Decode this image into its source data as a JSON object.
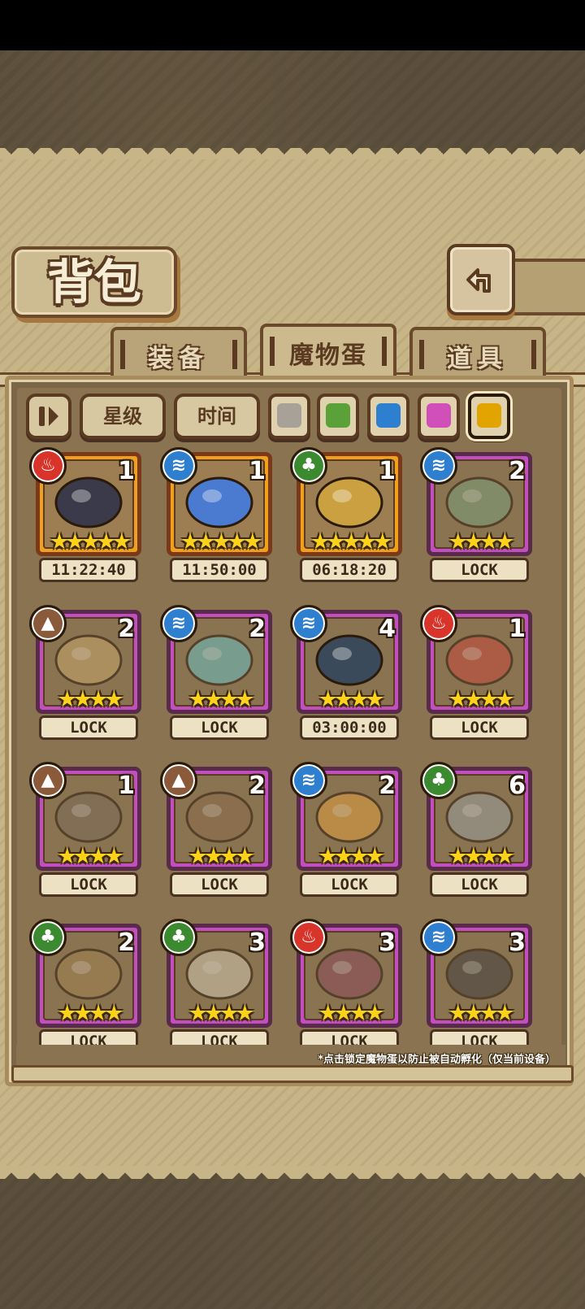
{
  "header": {
    "title": "背包"
  },
  "tabs": [
    {
      "label": "装备",
      "active": false
    },
    {
      "label": "魔物蛋",
      "active": true
    },
    {
      "label": "道具",
      "active": false
    }
  ],
  "filters": {
    "sort_toggle_icon": "sort-order-icon",
    "star_label": "星级",
    "time_label": "时间",
    "color_filters": [
      {
        "name": "gray",
        "color": "#a8a198"
      },
      {
        "name": "green",
        "color": "#5aa13a"
      },
      {
        "name": "blue",
        "color": "#2f7fd0"
      },
      {
        "name": "pink",
        "color": "#d04fb8"
      },
      {
        "name": "gold",
        "color": "#e2a400",
        "selected": true
      }
    ]
  },
  "eggs": [
    {
      "element": "fire",
      "count": "1",
      "stars": "★★★★★",
      "label": "11:22:40",
      "rarity": "gold",
      "icon": "pirate-hat-icon"
    },
    {
      "element": "water",
      "count": "1",
      "stars": "★★★★★",
      "label": "11:50:00",
      "rarity": "gold",
      "icon": "shark-fin-icon"
    },
    {
      "element": "grass",
      "count": "1",
      "stars": "★★★★★",
      "label": "06:18:20",
      "rarity": "gold",
      "icon": "magic-lamp-icon"
    },
    {
      "element": "water",
      "count": "2",
      "stars": "★★★★",
      "label": "LOCK",
      "rarity": "pink",
      "icon": "jellyfish-icon"
    },
    {
      "element": "earth",
      "count": "2",
      "stars": "★★★★",
      "label": "LOCK",
      "rarity": "pink",
      "icon": "furry-beast-icon"
    },
    {
      "element": "water",
      "count": "2",
      "stars": "★★★★",
      "label": "LOCK",
      "rarity": "pink",
      "icon": "spirit-blob-icon"
    },
    {
      "element": "water",
      "count": "4",
      "stars": "★★★★",
      "label": "03:00:00",
      "rarity": "pink",
      "icon": "hooded-knight-icon"
    },
    {
      "element": "fire",
      "count": "1",
      "stars": "★★★★",
      "label": "LOCK",
      "rarity": "pink",
      "icon": "mushroom-demon-icon"
    },
    {
      "element": "earth",
      "count": "1",
      "stars": "★★★★",
      "label": "LOCK",
      "rarity": "pink",
      "icon": "stone-gate-icon"
    },
    {
      "element": "earth",
      "count": "2",
      "stars": "★★★★",
      "label": "LOCK",
      "rarity": "pink",
      "icon": "bow-creature-icon"
    },
    {
      "element": "water",
      "count": "2",
      "stars": "★★★★",
      "label": "LOCK",
      "rarity": "pink",
      "icon": "pudding-snail-icon"
    },
    {
      "element": "grass",
      "count": "6",
      "stars": "★★★★",
      "label": "LOCK",
      "rarity": "pink",
      "icon": "horned-beast-icon"
    },
    {
      "element": "grass",
      "count": "2",
      "stars": "★★★★",
      "label": "LOCK",
      "rarity": "pink",
      "icon": "tiger-beast-icon"
    },
    {
      "element": "grass",
      "count": "3",
      "stars": "★★★★",
      "label": "LOCK",
      "rarity": "pink",
      "icon": "leaf-sprite-icon"
    },
    {
      "element": "fire",
      "count": "3",
      "stars": "★★★★",
      "label": "LOCK",
      "rarity": "pink",
      "icon": "bat-demon-icon"
    },
    {
      "element": "water",
      "count": "3",
      "stars": "★★★★",
      "label": "LOCK",
      "rarity": "pink",
      "icon": "panda-robot-icon"
    }
  ],
  "element_icons": {
    "fire": "fire-element-icon",
    "water": "water-element-icon",
    "grass": "leaf-element-icon",
    "earth": "earth-element-icon"
  },
  "footer_note": "*点击锁定魔物蛋以防止被自动孵化（仅当前设备）"
}
